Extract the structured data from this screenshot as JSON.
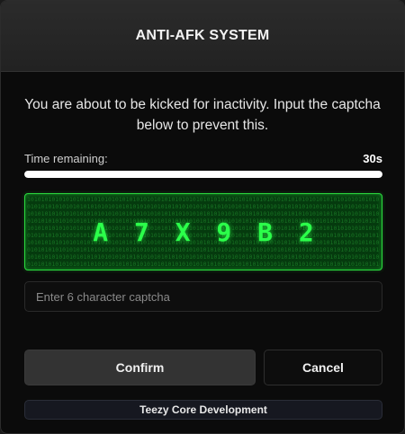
{
  "dialog": {
    "title": "ANTI-AFK SYSTEM",
    "message": "You are about to be kicked for inactivity. Input the captcha below to prevent this."
  },
  "timer": {
    "label": "Time remaining:",
    "value": "30s",
    "progress_fraction": 1.0
  },
  "captcha": {
    "code": "A7X9B2",
    "background_pattern": "1010",
    "colors": {
      "text": "#2bff4a",
      "border": "#2bdc3f",
      "background": "#053a0e"
    }
  },
  "input": {
    "placeholder": "Enter 6 character captcha",
    "value": ""
  },
  "buttons": {
    "confirm_label": "Confirm",
    "cancel_label": "Cancel"
  },
  "footer": {
    "text": "Teezy Core Development"
  }
}
